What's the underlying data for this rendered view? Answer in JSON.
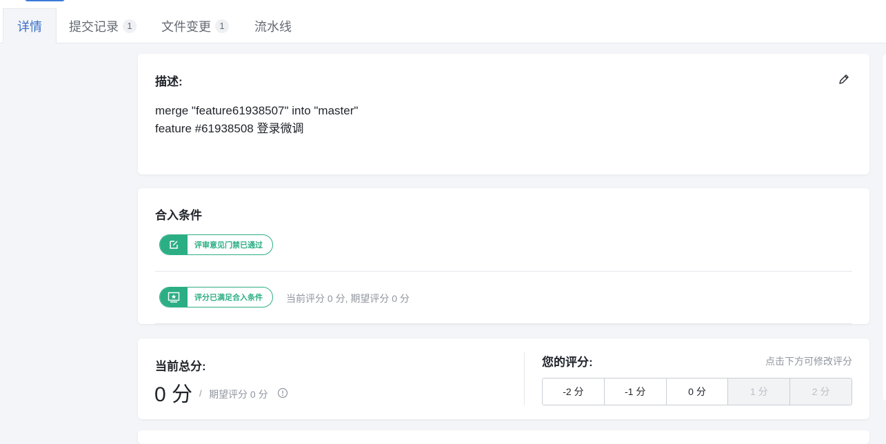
{
  "tabs": [
    {
      "label": "详情",
      "active": true
    },
    {
      "label": "提交记录",
      "count": "1"
    },
    {
      "label": "文件变更",
      "count": "1"
    },
    {
      "label": "流水线"
    }
  ],
  "description": {
    "title": "描述:",
    "lines": [
      "merge \"feature61938507\" into \"master\"",
      "feature #61938508 登录微调"
    ],
    "edit_icon": "pencil-icon"
  },
  "merge_conditions": {
    "title": "合入条件",
    "review_gate": {
      "label": "评审意见门禁已通过",
      "icon": "edit-square-icon"
    },
    "score_gate": {
      "label": "评分已满足合入条件",
      "icon": "star-card-icon"
    },
    "score_info": "当前评分 0 分, 期望评分 0 分"
  },
  "score": {
    "current_title": "当前总分:",
    "current_value": "0 分",
    "separator": "/",
    "expected": "期望评分 0 分",
    "info_icon": "info-circle-icon",
    "your_title": "您的评分:",
    "hint": "点击下方可修改评分",
    "buttons": [
      {
        "label": "-2 分",
        "disabled": false
      },
      {
        "label": "-1 分",
        "disabled": false
      },
      {
        "label": "0 分",
        "disabled": false
      },
      {
        "label": "1 分",
        "disabled": true
      },
      {
        "label": "2 分",
        "disabled": true
      }
    ]
  },
  "colors": {
    "accent": "#3b6fc9",
    "success": "#2cae84",
    "background": "#f3f5f8"
  }
}
